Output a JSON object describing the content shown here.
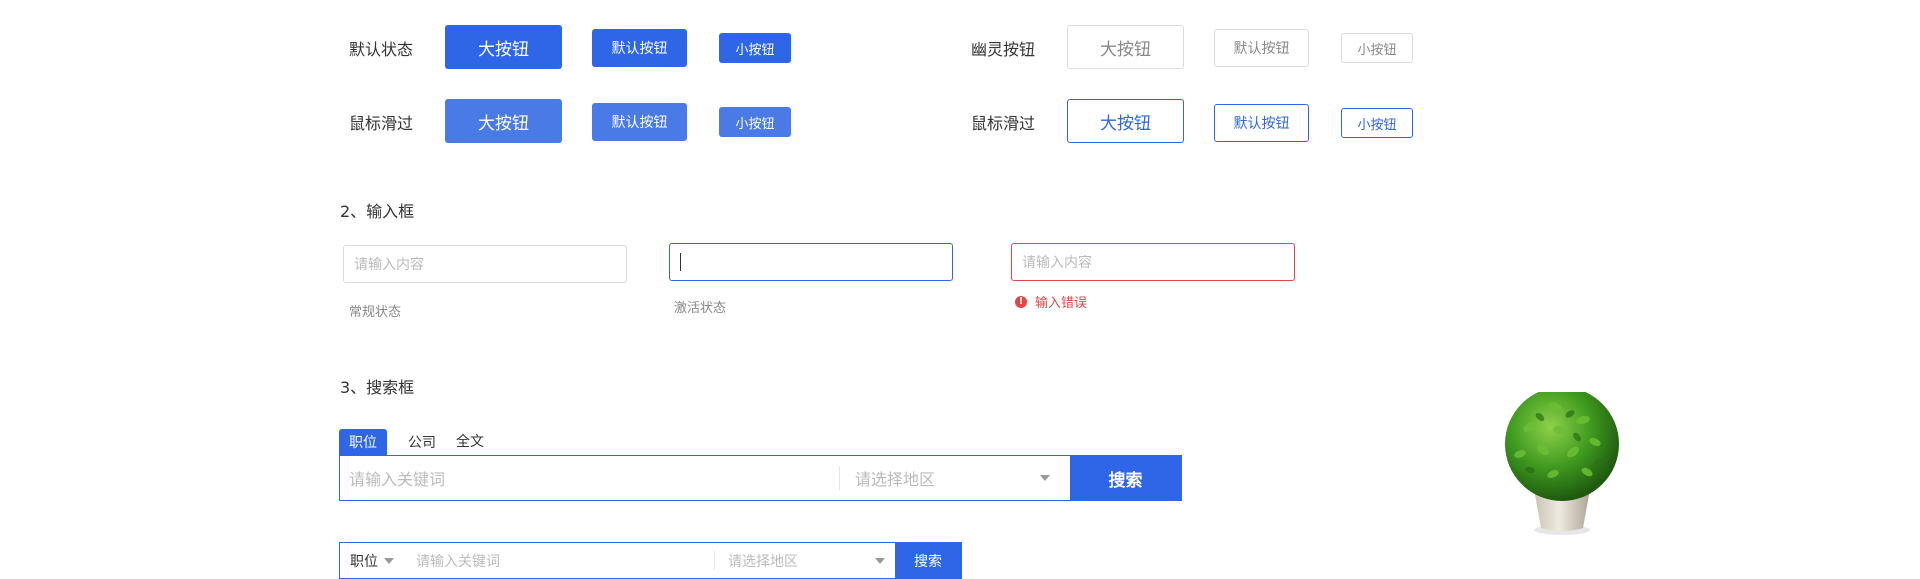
{
  "buttons": {
    "default_label": "默认状态",
    "hover_label": "鼠标滑过",
    "ghost_label": "幽灵按钮",
    "ghost_hover_label": "鼠标滑过",
    "large": "大按钮",
    "medium": "默认按钮",
    "small": "小按钮"
  },
  "inputs": {
    "title": "2、输入框",
    "placeholder": "请输入内容",
    "normal_hint": "常规状态",
    "active_hint": "激活状态",
    "error_placeholder": "请输入内容",
    "error_text": "输入错误",
    "error_icon": "!"
  },
  "search": {
    "title": "3、搜索框",
    "tabs": [
      "职位",
      "公司",
      "全文"
    ],
    "keyword_placeholder": "请输入关键词",
    "region_placeholder": "请选择地区",
    "button": "搜索",
    "compact": {
      "category": "职位",
      "keyword_placeholder": "请输入关键词",
      "region_placeholder": "请选择地区",
      "button": "搜索"
    }
  },
  "decor": {
    "plant": "potted-plant-image"
  },
  "colors": {
    "primary": "#2e66e7",
    "primary_hover": "#4a7ae6",
    "error": "#e54545"
  }
}
